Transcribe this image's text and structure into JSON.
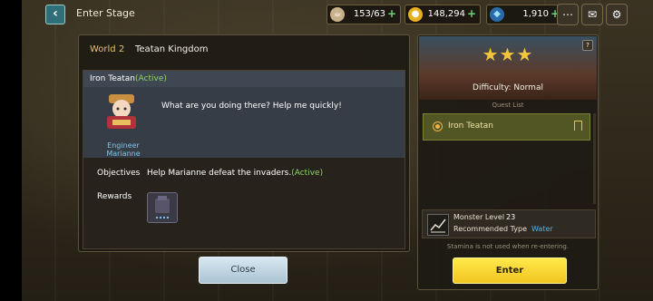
{
  "topbar": {
    "back_icon": "back-arrow-icon",
    "title": "Enter Stage",
    "stamina": "153/63",
    "gold": "148,294",
    "gems": "1,910"
  },
  "panel": {
    "world": "World 2",
    "kingdom": "Teatan Kingdom"
  },
  "quest": {
    "name": "Iron Teatan",
    "status": "(Active)",
    "npc_name": "Engineer Marianne",
    "dialog": "What are you doing there? Help me quickly!",
    "objectives_label": "Objectives",
    "objective_text": "Help Marianne defeat the invaders.",
    "objective_status": "(Active)",
    "rewards_label": "Rewards"
  },
  "close_label": "Close",
  "stage": {
    "difficulty": "Difficulty: Normal",
    "stars_earned": 3,
    "help": "?",
    "quest_list_title": "Quest List",
    "quest_items": [
      {
        "name": "Iron Teatan"
      }
    ],
    "monster_level_label": "Monster Level",
    "monster_level": "23",
    "rec_type_label": "Recommended Type",
    "rec_type": "Water",
    "stamina_note": "Stamina is not used when re-entering.",
    "enter_label": "Enter"
  },
  "colors": {
    "active": "#8fd36a",
    "water": "#4fb3f0",
    "enter_button": "#f2c420"
  }
}
